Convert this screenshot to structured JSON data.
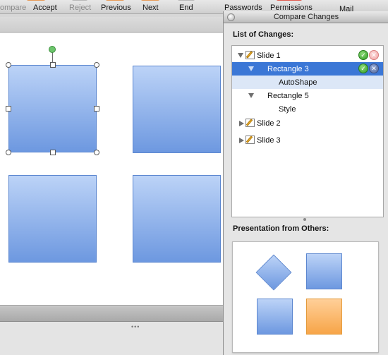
{
  "toolbar": {
    "items": [
      {
        "label": "ompare",
        "enabled": false
      },
      {
        "label": "Accept",
        "enabled": true
      },
      {
        "label": "Reject",
        "enabled": false
      },
      {
        "label": "Previous",
        "enabled": true
      },
      {
        "label": "Next",
        "enabled": true
      },
      {
        "label": "End",
        "enabled": true
      },
      {
        "label": "Passwords",
        "enabled": true
      },
      {
        "label": "Permissions",
        "enabled": true
      },
      {
        "label": "Mail",
        "enabled": true
      }
    ]
  },
  "panel": {
    "title": "Compare Changes",
    "list_label": "List of Changes:",
    "preview_label": "Presentation from Others:",
    "tree": [
      {
        "label": "Slide 1",
        "level": 0,
        "expanded": true,
        "icon": "slide-icon",
        "actions": true
      },
      {
        "label": "Rectangle 3",
        "level": 1,
        "expanded": true,
        "selected": true,
        "actions": true
      },
      {
        "label": "AutoShape",
        "level": 2,
        "highlighted": true
      },
      {
        "label": "Rectangle 5",
        "level": 1,
        "expanded": true
      },
      {
        "label": "Style",
        "level": 2
      },
      {
        "label": "Slide 2",
        "level": 0,
        "expanded": false,
        "icon": "slide-icon"
      },
      {
        "label": "Slide 3",
        "level": 0,
        "expanded": false,
        "icon": "slide-icon"
      }
    ]
  },
  "colors": {
    "shape_fill_top": "#bcd3f7",
    "shape_fill_bottom": "#6d98e0",
    "selection": "#3b77d6",
    "accept": "#2f9b23",
    "orange_shape": "#f7a548"
  }
}
